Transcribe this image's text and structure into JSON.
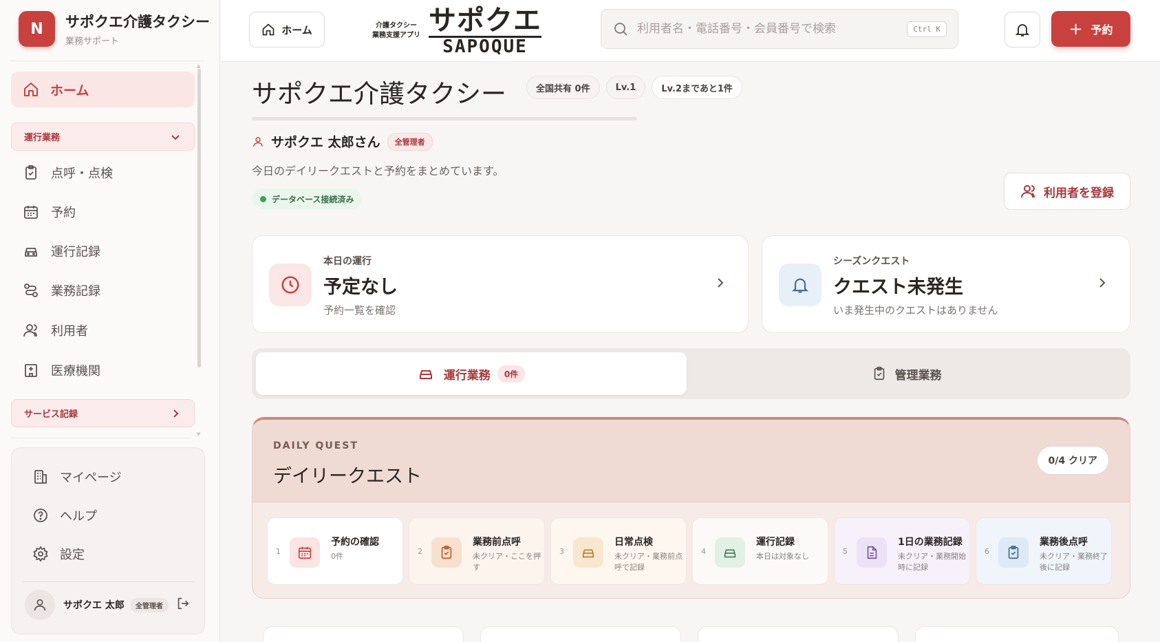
{
  "sidebar": {
    "brand_initial": "N",
    "brand_title": "サポクエ介護タクシー",
    "brand_sub": "業務サポート",
    "home": "ホーム",
    "group_ops": "運行業務",
    "ops_items": [
      {
        "label": "点呼・点検",
        "icon": "clipboard-check-icon"
      },
      {
        "label": "予約",
        "icon": "calendar-icon"
      },
      {
        "label": "運行記録",
        "icon": "car-icon"
      },
      {
        "label": "業務記録",
        "icon": "route-icon"
      },
      {
        "label": "利用者",
        "icon": "users-icon"
      },
      {
        "label": "医療機関",
        "icon": "hospital-icon"
      }
    ],
    "group_service": "サービス記録",
    "bottom_items": [
      {
        "label": "マイページ",
        "icon": "building-icon"
      },
      {
        "label": "ヘルプ",
        "icon": "help-icon"
      },
      {
        "label": "設定",
        "icon": "gear-icon"
      }
    ],
    "user_name": "サポクエ 太郎",
    "user_role": "全管理者"
  },
  "header": {
    "home_label": "ホーム",
    "logo_sub_line1": "介護タクシー",
    "logo_sub_line2": "業務支援アプリ",
    "logo_jp": "サポクエ",
    "logo_en": "SAPOQUE",
    "search_placeholder": "利用者名・電話番号・会員番号で検索",
    "search_shortcut": "Ctrl K",
    "reserve_label": "予約"
  },
  "main": {
    "title": "サポクエ介護タクシー",
    "badges": [
      "全国共有 0件",
      "Lv.1",
      "Lv.2まであと1件"
    ],
    "user_name": "サポクエ 太郎さん",
    "user_role": "全管理者",
    "intro": "今日のデイリークエストと予約をまとめています。",
    "db_status": "データベース接続済み",
    "register_label": "利用者を登録",
    "card_today": {
      "kicker": "本日の運行",
      "main": "予定なし",
      "sub": "予約一覧を確認"
    },
    "card_season": {
      "kicker": "シーズンクエスト",
      "main": "クエスト未発生",
      "sub": "いま発生中のクエストはありません"
    },
    "tab_ops": "運行業務",
    "tab_ops_count": "0件",
    "tab_admin": "管理業務",
    "daily": {
      "kicker": "DAILY QUEST",
      "title": "デイリークエスト",
      "clear": "0/4 クリア",
      "items": [
        {
          "num": "1",
          "title": "予約の確認",
          "sub": "0件",
          "icon": "calendar-icon"
        },
        {
          "num": "2",
          "title": "業務前点呼",
          "sub": "未クリア・ここを押す",
          "icon": "clipboard-check-icon"
        },
        {
          "num": "3",
          "title": "日常点検",
          "sub": "未クリア・業務前点呼で記録",
          "icon": "car-icon"
        },
        {
          "num": "4",
          "title": "運行記録",
          "sub": "本日は対象なし",
          "icon": "car-icon"
        },
        {
          "num": "5",
          "title": "1日の業務記録",
          "sub": "未クリア・業務開始時に記録",
          "icon": "document-icon"
        },
        {
          "num": "6",
          "title": "業務後点呼",
          "sub": "未クリア・業務終了後に記録",
          "icon": "clipboard-check-icon"
        }
      ]
    }
  },
  "colors": {
    "accent": "#c8413f",
    "accent_dark": "#a8373a",
    "bg": "#f8f6f5"
  }
}
